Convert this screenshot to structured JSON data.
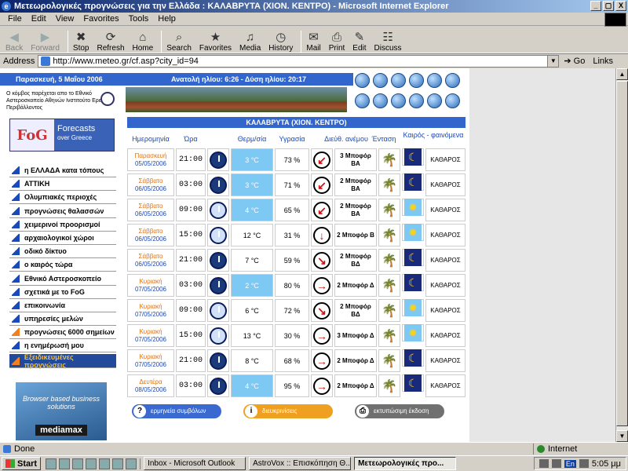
{
  "window": {
    "title": "Μετεωρολογικές προγνώσεις για την Ελλάδα : ΚΑΛΑΒΡΥΤΑ (ΧΙΟΝ. ΚΕΝΤΡΟ) - Microsoft Internet Explorer",
    "controls": [
      "_",
      "▢",
      "X"
    ]
  },
  "menu": [
    "File",
    "Edit",
    "View",
    "Favorites",
    "Tools",
    "Help"
  ],
  "toolbar": [
    {
      "label": "Back",
      "icon": "back-arrow-icon",
      "glyph": "◀",
      "disabled": true
    },
    {
      "label": "Forward",
      "icon": "forward-arrow-icon",
      "glyph": "▶",
      "disabled": true
    },
    {
      "label": "Stop",
      "icon": "stop-icon",
      "glyph": "✖",
      "disabled": false
    },
    {
      "label": "Refresh",
      "icon": "refresh-icon",
      "glyph": "⟳",
      "disabled": false
    },
    {
      "label": "Home",
      "icon": "home-icon",
      "glyph": "⌂",
      "disabled": false
    },
    {
      "label": "Search",
      "icon": "search-icon",
      "glyph": "⌕",
      "disabled": false
    },
    {
      "label": "Favorites",
      "icon": "favorites-icon",
      "glyph": "★",
      "disabled": false
    },
    {
      "label": "Media",
      "icon": "media-icon",
      "glyph": "♫",
      "disabled": false
    },
    {
      "label": "History",
      "icon": "history-icon",
      "glyph": "◷",
      "disabled": false
    },
    {
      "label": "Mail",
      "icon": "mail-icon",
      "glyph": "✉",
      "disabled": false
    },
    {
      "label": "Print",
      "icon": "print-icon",
      "glyph": "⎙",
      "disabled": false
    },
    {
      "label": "Edit",
      "icon": "edit-icon",
      "glyph": "✎",
      "disabled": false
    },
    {
      "label": "Discuss",
      "icon": "discuss-icon",
      "glyph": "☷",
      "disabled": false
    }
  ],
  "address": {
    "label": "Address",
    "url": "http://www.meteo.gr/cf.asp?city_id=94",
    "go": "Go",
    "links": "Links"
  },
  "page": {
    "date": "Παρασκευή, 5 Μαΐου 2006",
    "sun": "Ανατολή ηλίου: 6:26 - Δύση ηλίου: 20:17",
    "observatory": "Ο κόμβος παρέχεται απο το Εθνικό Αστεροσκοπείο Αθηνών Ινστιτούτο Ερευνών Περιβάλλοντος",
    "fog_logo": "FoG",
    "fog_title": "Forecasts",
    "fog_sub": "over Greece",
    "nav": [
      "η ΕΛΛΑΔΑ κατα τόπους",
      "ΑΤΤΙΚΗ",
      "Ολυμπιακές περιοχές",
      "προγνώσεις θαλασσών",
      "χειμερινοί προορισμοί",
      "αρχαιολογικοί χώροι",
      "οδικό δίκτυο",
      "ο καιρός τώρα",
      "Εθνικό Αστεροσκοπείο",
      "σχετικά με το FoG",
      "επικοινωνία",
      "υπηρεσίες μελών",
      "προγνώσεις 6000 σημείων",
      "η ενημέρωσή μου",
      "Εξειδικευμένες προγνώσεις"
    ],
    "ad_text": "Browser based business solutions",
    "ad_brand": "mediamax",
    "location": "ΚΑΛΑΒΡΥΤΑ (ΧΙΟΝ. ΚΕΝΤΡΟ)",
    "columns": {
      "date": "Ημερομηνία",
      "time": "Ώρα",
      "temp": "Θερμ/σία",
      "hum": "Υγρασία",
      "wind": "Διεύθ. ανέμου",
      "speed": "Ένταση",
      "weather": "Καιρός - φαινόμενα"
    },
    "rows": [
      {
        "day": "Παρασκευή",
        "date": "05/05/2006",
        "time": "21:00",
        "night": true,
        "temp": "3 °C",
        "cold": true,
        "hum": "73 %",
        "arrow": "↙",
        "wind": "3 Μποφόρ ΒΑ",
        "sky": "moon",
        "desc": "ΚΑΘΑΡΟΣ"
      },
      {
        "day": "Σάββατο",
        "date": "06/05/2006",
        "time": "03:00",
        "night": true,
        "temp": "3 °C",
        "cold": true,
        "hum": "71 %",
        "arrow": "↙",
        "wind": "2 Μποφόρ ΒΑ",
        "sky": "moon",
        "desc": "ΚΑΘΑΡΟΣ"
      },
      {
        "day": "Σάββατο",
        "date": "06/05/2006",
        "time": "09:00",
        "night": false,
        "temp": "4 °C",
        "cold": true,
        "hum": "65 %",
        "arrow": "↙",
        "wind": "2 Μποφόρ ΒΑ",
        "sky": "sun",
        "desc": "ΚΑΘΑΡΟΣ"
      },
      {
        "day": "Σάββατο",
        "date": "06/05/2006",
        "time": "15:00",
        "night": false,
        "temp": "12 °C",
        "cold": false,
        "hum": "31 %",
        "arrow": "↓",
        "wind": "2 Μποφόρ Β",
        "sky": "sun",
        "desc": "ΚΑΘΑΡΟΣ"
      },
      {
        "day": "Σάββατο",
        "date": "06/05/2006",
        "time": "21:00",
        "night": true,
        "temp": "7 °C",
        "cold": false,
        "hum": "59 %",
        "arrow": "↘",
        "wind": "2 Μποφόρ ΒΔ",
        "sky": "moon",
        "desc": "ΚΑΘΑΡΟΣ"
      },
      {
        "day": "Κυριακή",
        "date": "07/05/2006",
        "time": "03:00",
        "night": true,
        "temp": "2 °C",
        "cold": true,
        "hum": "80 %",
        "arrow": "→",
        "wind": "2 Μποφόρ Δ",
        "sky": "moon",
        "desc": "ΚΑΘΑΡΟΣ"
      },
      {
        "day": "Κυριακή",
        "date": "07/05/2006",
        "time": "09:00",
        "night": false,
        "temp": "6 °C",
        "cold": false,
        "hum": "72 %",
        "arrow": "↘",
        "wind": "2 Μποφόρ ΒΔ",
        "sky": "sun",
        "desc": "ΚΑΘΑΡΟΣ"
      },
      {
        "day": "Κυριακή",
        "date": "07/05/2006",
        "time": "15:00",
        "night": false,
        "temp": "13 °C",
        "cold": false,
        "hum": "30 %",
        "arrow": "→",
        "wind": "3 Μποφόρ Δ",
        "sky": "sun",
        "desc": "ΚΑΘΑΡΟΣ"
      },
      {
        "day": "Κυριακή",
        "date": "07/05/2006",
        "time": "21:00",
        "night": true,
        "temp": "8 °C",
        "cold": false,
        "hum": "68 %",
        "arrow": "→",
        "wind": "2 Μποφόρ Δ",
        "sky": "moon",
        "desc": "ΚΑΘΑΡΟΣ"
      },
      {
        "day": "Δευτέρα",
        "date": "08/05/2006",
        "time": "03:00",
        "night": true,
        "temp": "4 °C",
        "cold": true,
        "hum": "95 %",
        "arrow": "→",
        "wind": "2 Μποφόρ Δ",
        "sky": "moon",
        "desc": "ΚΑΘΑΡΟΣ"
      }
    ],
    "buttons": [
      {
        "label": "ερμηνεία συμβόλων",
        "glyph": "?",
        "color": "#3a6ad0"
      },
      {
        "label": "διευκρινίσεις",
        "glyph": "i",
        "color": "#f0a020"
      },
      {
        "label": "εκτυπώσιμη έκδοση",
        "glyph": "⎙",
        "color": "#707070"
      }
    ]
  },
  "status": {
    "left": "Done",
    "right": "Internet"
  },
  "taskbar": {
    "start": "Start",
    "tasks": [
      "Inbox - Microsoft Outlook",
      "AstroVox :: Επισκόπηση Θ...",
      "Μετεωρολογικές προ..."
    ],
    "lang": "En",
    "clock": "5:05 μμ"
  },
  "colors": {
    "accent": "#3366cc",
    "cold_temp": "#7ec8f4",
    "day_label": "#e07010"
  }
}
